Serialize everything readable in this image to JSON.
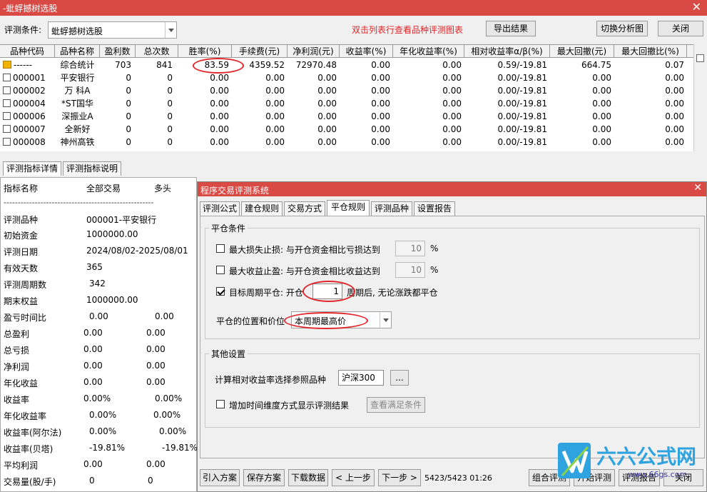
{
  "window": {
    "title": "-蚍蜉撼树选股",
    "close_glyph": "✕"
  },
  "toolbar": {
    "condition_label": "评测条件:",
    "condition_value": "蚍蜉撼树选股",
    "hint": "双击列表行查看品种评测图表",
    "export_label": "导出结果",
    "switch_label": "切换分析图",
    "close_label": "关闭",
    "hint_color": "#e0262a"
  },
  "grid": {
    "headers": [
      "品种代码",
      "品种名称",
      "盈利数",
      "总次数",
      "胜率(%)",
      "手续费(元)",
      "净利润(元)",
      "收益率(%)",
      "年化收益率(%)",
      "相对收益率α/β(%)",
      "最大回撤(元)",
      "最大回撤比(%)"
    ],
    "rows": [
      {
        "code": "------",
        "name": "综合统计",
        "wins": "703",
        "total": "841",
        "winrate": "83.59",
        "fee": "4359.52",
        "profit": "72970.48",
        "ret": "0.00",
        "annual": "0.00",
        "alpha": "0.59/-19.81",
        "maxdd": "664.75",
        "maxddr": "0.07"
      },
      {
        "code": "000001",
        "name": "平安银行",
        "wins": "0",
        "total": "0",
        "winrate": "0.00",
        "fee": "0.00",
        "profit": "0.00",
        "ret": "0.00",
        "annual": "0.00",
        "alpha": "0.00/-19.81",
        "maxdd": "0.00",
        "maxddr": "0.00"
      },
      {
        "code": "000002",
        "name": "万 科A",
        "wins": "0",
        "total": "0",
        "winrate": "0.00",
        "fee": "0.00",
        "profit": "0.00",
        "ret": "0.00",
        "annual": "0.00",
        "alpha": "0.00/-19.81",
        "maxdd": "0.00",
        "maxddr": "0.00"
      },
      {
        "code": "000004",
        "name": "*ST国华",
        "wins": "0",
        "total": "0",
        "winrate": "0.00",
        "fee": "0.00",
        "profit": "0.00",
        "ret": "0.00",
        "annual": "0.00",
        "alpha": "0.00/-19.81",
        "maxdd": "0.00",
        "maxddr": "0.00"
      },
      {
        "code": "000006",
        "name": "深振业A",
        "wins": "0",
        "total": "0",
        "winrate": "0.00",
        "fee": "0.00",
        "profit": "0.00",
        "ret": "0.00",
        "annual": "0.00",
        "alpha": "0.00/-19.81",
        "maxdd": "0.00",
        "maxddr": "0.00"
      },
      {
        "code": "000007",
        "name": "全新好",
        "wins": "0",
        "total": "0",
        "winrate": "0.00",
        "fee": "0.00",
        "profit": "0.00",
        "ret": "0.00",
        "annual": "0.00",
        "alpha": "0.00/-19.81",
        "maxdd": "0.00",
        "maxddr": "0.00"
      },
      {
        "code": "000008",
        "name": "神州高铁",
        "wins": "0",
        "total": "0",
        "winrate": "0.00",
        "fee": "0.00",
        "profit": "0.00",
        "ret": "0.00",
        "annual": "0.00",
        "alpha": "0.00/-19.81",
        "maxdd": "0.00",
        "maxddr": "0.00"
      }
    ]
  },
  "bottom_tabs": [
    "评测指标详情",
    "评测指标说明"
  ],
  "left_panel": {
    "headers": [
      "指标名称",
      "全部交易",
      "多头"
    ],
    "separator": "-----------------------------------------------------",
    "rows": [
      {
        "name": "评测品种",
        "all": "000001-平安银行",
        "long": ""
      },
      {
        "name": "初始资金",
        "all": "1000000.00",
        "long": ""
      },
      {
        "name": "评测日期",
        "all": "2024/08/02-2025/08/01",
        "long": ""
      },
      {
        "name": "有效天数",
        "all": "365",
        "long": ""
      },
      {
        "name": "评测周期数",
        "all": "342",
        "long": ""
      },
      {
        "name": "期末权益",
        "all": "1000000.00",
        "long": ""
      },
      {
        "name": "盈亏时间比",
        "all": "0.00",
        "long": "0.00"
      },
      {
        "name": "总盈利",
        "all": "0.00",
        "long": "0.00"
      },
      {
        "name": "总亏损",
        "all": "0.00",
        "long": "0.00"
      },
      {
        "name": "净利润",
        "all": "0.00",
        "long": "0.00"
      },
      {
        "name": "年化收益",
        "all": "0.00",
        "long": "0.00"
      },
      {
        "name": "收益率",
        "all": "0.00%",
        "long": "0.00%"
      },
      {
        "name": "年化收益率",
        "all": "0.00%",
        "long": "0.00%"
      },
      {
        "name": "收益率(阿尔法)",
        "all": "0.00%",
        "long": "0.00%"
      },
      {
        "name": "收益率(贝塔)",
        "all": "-19.81%",
        "long": "-19.81%"
      },
      {
        "name": "平均利润",
        "all": "0.00",
        "long": "0.00"
      },
      {
        "name": "交易量(股/手)",
        "all": "0",
        "long": "0"
      }
    ]
  },
  "dialog": {
    "title": "程序交易评测系统",
    "tabs": [
      "评测公式",
      "建仓规则",
      "交易方式",
      "平仓规则",
      "评测品种",
      "设置报告"
    ],
    "active_tab": 3,
    "close_group": {
      "title": "平仓条件",
      "max_loss": {
        "label": "最大损失止损: 与开仓资金相比亏损达到",
        "value": "10",
        "unit": "%",
        "checked": false
      },
      "max_gain": {
        "label": "最大收益止盈: 与开仓资金相比收益达到",
        "value": "10",
        "unit": "%",
        "checked": false
      },
      "target_period": {
        "label_before": "目标周期平仓: 开仓",
        "value": "1",
        "label_after": "周期后, 无论涨跌都平仓",
        "checked": true
      },
      "position_label": "平仓的位置和价位",
      "position_value": "本周期最高价"
    },
    "other_group": {
      "title": "其他设置",
      "ref_label": "计算相对收益率选择参照品种",
      "ref_value": "沪深300",
      "ref_btn": "...",
      "time_label": "增加时间维度方式显示评测结果",
      "time_checked": false,
      "view_btn": "查看满足条件"
    },
    "buttons": {
      "import": "引入方案",
      "save": "保存方案",
      "download": "下载数据",
      "prev": "< 上一步",
      "next": "下一步 >",
      "progress": "5423/5423 01:26",
      "combo": "组合评测",
      "start": "开始评测",
      "report": "评测报告",
      "close": "关闭"
    }
  },
  "watermark": {
    "brand": "六六公式网",
    "url": "www.66gs.com"
  }
}
